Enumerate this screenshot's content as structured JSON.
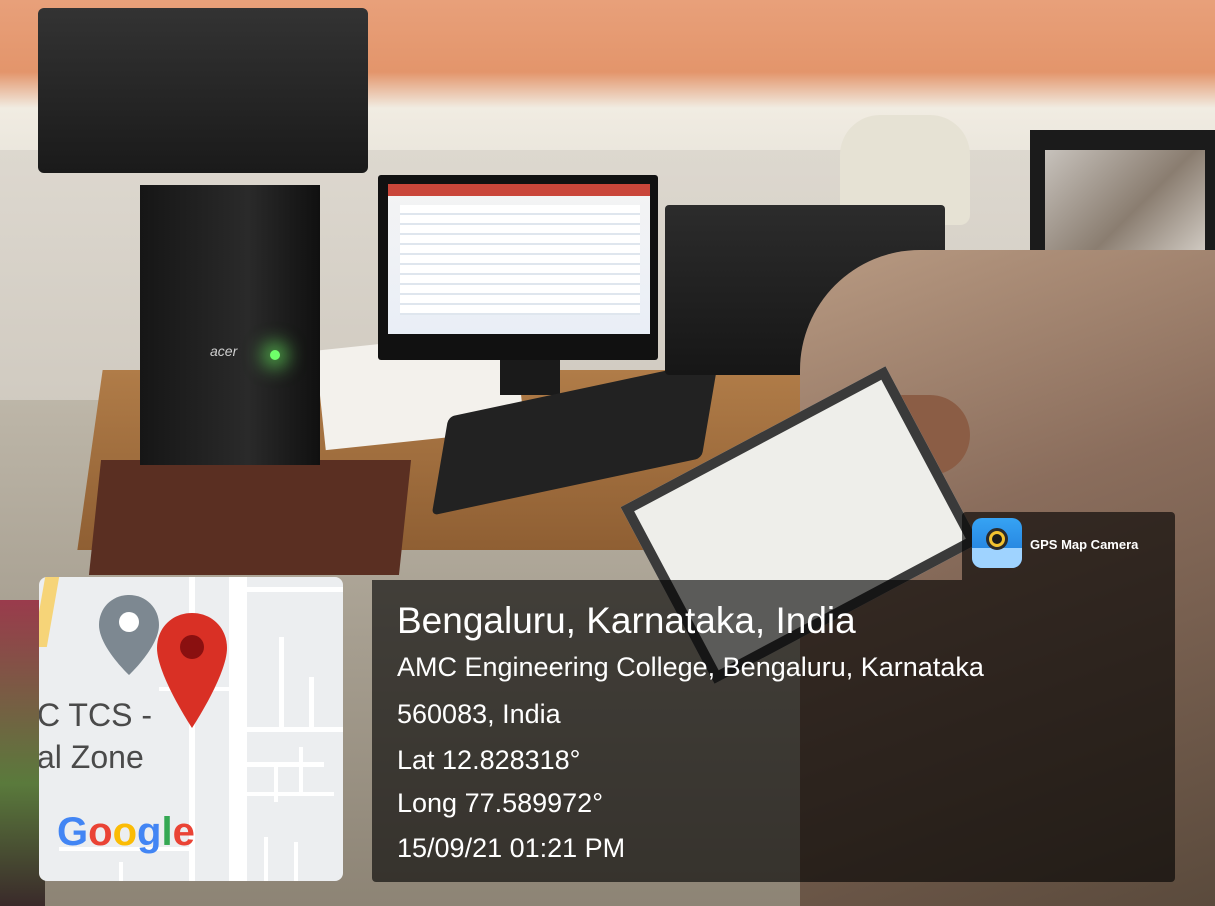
{
  "overlay": {
    "app_name": "GPS Map Camera",
    "location_title": "Bengaluru, Karnataka, India",
    "address_line1": "AMC Engineering College, Bengaluru, Karnataka",
    "address_line2": "560083, India",
    "latitude": "Lat 12.828318°",
    "longitude": "Long 77.589972°",
    "datetime": "15/09/21 01:21 PM"
  },
  "map": {
    "label_line1": "C TCS -",
    "label_line2": "al Zone",
    "brand": [
      "G",
      "o",
      "o",
      "g",
      "l",
      "e"
    ],
    "brand_colors": [
      "#4285F4",
      "#EA4335",
      "#FBBC05",
      "#4285F4",
      "#34A853",
      "#EA4335"
    ],
    "marker_color": "#D93025",
    "secondary_marker_color": "#7d8891"
  },
  "scene": {
    "tower_brand": "acer"
  }
}
